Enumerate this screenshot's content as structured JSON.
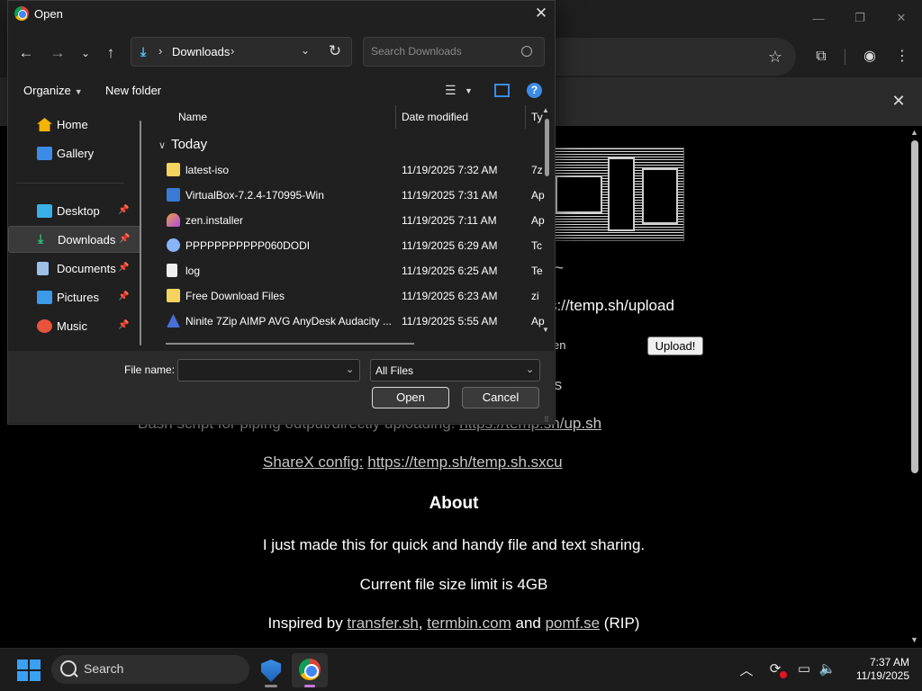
{
  "dialog": {
    "title": "Open",
    "address": {
      "location": "Downloads",
      "separator_after": "›",
      "separator_before": "›"
    },
    "search_placeholder": "Search Downloads",
    "commands": {
      "organize": "Organize",
      "new_folder": "New folder"
    },
    "nav_items": [
      {
        "label": "Home",
        "icon": "home-icon",
        "color": "#f4b400",
        "pinned": false
      },
      {
        "label": "Gallery",
        "icon": "gallery-icon",
        "color": "#3c8ce7",
        "pinned": false
      },
      {
        "label": "Desktop",
        "icon": "desktop-icon",
        "color": "#3ab0e8",
        "pinned": true
      },
      {
        "label": "Downloads",
        "icon": "downloads-icon",
        "color": "#2ec27e",
        "pinned": true
      },
      {
        "label": "Documents",
        "icon": "documents-icon",
        "color": "#9ec0e8",
        "pinned": true
      },
      {
        "label": "Pictures",
        "icon": "pictures-icon",
        "color": "#3c9ae8",
        "pinned": true
      },
      {
        "label": "Music",
        "icon": "music-icon",
        "color": "#e8533c",
        "pinned": true
      }
    ],
    "columns": {
      "name": "Name",
      "date": "Date modified",
      "type": "Ty"
    },
    "group": "Today",
    "files": [
      {
        "name": "latest-iso",
        "date": "11/19/2025 7:32 AM",
        "type": "7z",
        "icon": "archive-icon",
        "color": "#f4d35e"
      },
      {
        "name": "VirtualBox-7.2.4-170995-Win",
        "date": "11/19/2025 7:31 AM",
        "type": "Ap",
        "icon": "virtualbox-icon",
        "color": "#3a7bd5"
      },
      {
        "name": "zen.installer",
        "date": "11/19/2025 7:11 AM",
        "type": "Ap",
        "icon": "zen-icon",
        "color": "#e8a040"
      },
      {
        "name": "PPPPPPPPPPP060DODI",
        "date": "11/19/2025 6:29 AM",
        "type": "Tc",
        "icon": "torrent-icon",
        "color": "#8ab4f8"
      },
      {
        "name": "log",
        "date": "11/19/2025 6:25 AM",
        "type": "Te",
        "icon": "text-file-icon",
        "color": "#eeeeee"
      },
      {
        "name": "Free Download Files",
        "date": "11/19/2025 6:23 AM",
        "type": "zi",
        "icon": "zip-icon",
        "color": "#f4d35e"
      },
      {
        "name": "Ninite 7Zip AIMP AVG AnyDesk Audacity ...",
        "date": "11/19/2025 5:55 AM",
        "type": "Ap",
        "icon": "ninite-icon",
        "color": "#4a6fd8"
      }
    ],
    "footer": {
      "file_name_label": "File name:",
      "file_name_value": "",
      "file_type": "All Files",
      "open_label": "Open",
      "cancel_label": "Cancel"
    }
  },
  "page": {
    "upload_url_fragment": "s://temp.sh/upload",
    "en_fragment": "en",
    "upload_button": "Upload!",
    "rs_fragment": "rs",
    "bash_prefix": "Bash script for piping output/directly uploading: ",
    "bash_link": "https://temp.sh/up.sh",
    "sharex_label": "ShareX config:",
    "sharex_link": "https://temp.sh/temp.sh.sxcu",
    "about_heading": "About",
    "about_text": "I just made this for quick and handy file and text sharing.",
    "size_limit": "Current file size limit is 4GB",
    "inspired_prefix": "Inspired by ",
    "inspired_links": [
      "transfer.sh",
      "termbin.com",
      "pomf.se"
    ],
    "inspired_sep1": ", ",
    "inspired_and": " and ",
    "inspired_suffix": " (RIP)",
    "tilde": "~"
  },
  "taskbar": {
    "search_label": "Search",
    "time": "7:37 AM",
    "date": "11/19/2025"
  }
}
